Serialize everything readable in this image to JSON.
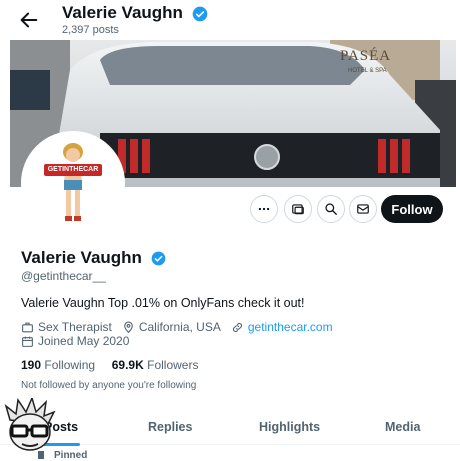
{
  "header": {
    "title": "Valerie Vaughn",
    "posts": "2,397 posts"
  },
  "profile": {
    "name": "Valerie Vaughn",
    "handle": "@getinthecar__",
    "bio": "Valerie Vaughn Top .01% on OnlyFans check it out!",
    "category": "Sex Therapist",
    "location": "California, USA",
    "website": "getinthecar.com",
    "joined": "Joined May 2020",
    "following_count": "190",
    "following_label": "Following",
    "followers_count": "69.9K",
    "followers_label": "Followers",
    "not_followed": "Not followed by anyone you're following",
    "avatar_text": "GETINTHECAR"
  },
  "banner": {
    "sign_title": "PASÉA",
    "sign_sub": "HOTEL & SPA"
  },
  "actions": {
    "follow_label": "Follow"
  },
  "tabs": [
    {
      "label": "Posts"
    },
    {
      "label": "Replies"
    },
    {
      "label": "Highlights"
    },
    {
      "label": "Media"
    }
  ],
  "pinned": "Pinned",
  "colors": {
    "accent": "#1d9bf0",
    "text": "#0f1419",
    "muted": "#536471",
    "follow_bg": "#0f1419"
  }
}
